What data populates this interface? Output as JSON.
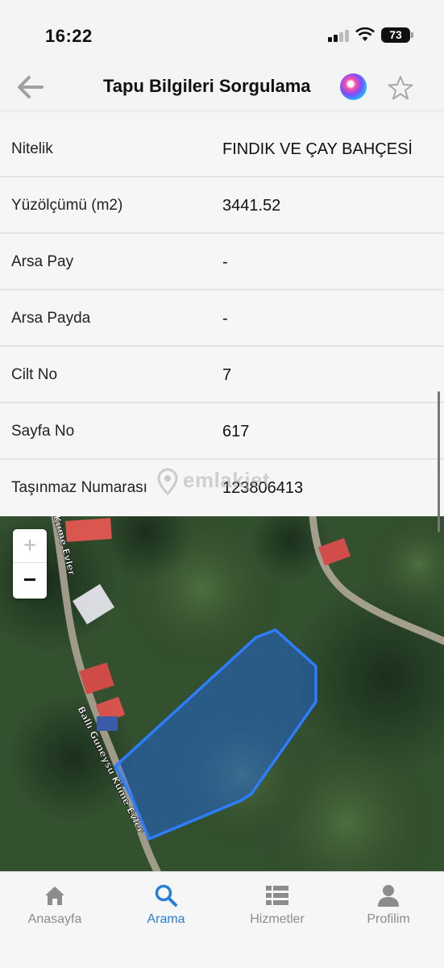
{
  "status_bar": {
    "time": "16:22",
    "battery": "73"
  },
  "header": {
    "title": "Tapu Bilgileri Sorgulama"
  },
  "info_rows": [
    {
      "label": "Nitelik",
      "value": "FINDIK VE ÇAY BAHÇESİ"
    },
    {
      "label": "Yüzölçümü (m2)",
      "value": "3441.52"
    },
    {
      "label": "Arsa Pay",
      "value": "-"
    },
    {
      "label": "Arsa Payda",
      "value": "-"
    },
    {
      "label": "Cilt No",
      "value": "7"
    },
    {
      "label": "Sayfa No",
      "value": "617"
    },
    {
      "label": "Taşınmaz Numarası",
      "value": "123806413"
    }
  ],
  "watermark": "emlakjet",
  "map": {
    "zoom_in": "+",
    "zoom_out": "−",
    "road_label_top": "Küme Evler",
    "road_label_bottom": "Ballı Güneysu Küme Evler",
    "parcel_color": "#1e6cff"
  },
  "tabs": [
    {
      "label": "Anasayfa",
      "icon": "home-icon",
      "active": false
    },
    {
      "label": "Arama",
      "icon": "search-icon",
      "active": true
    },
    {
      "label": "Hizmetler",
      "icon": "list-icon",
      "active": false
    },
    {
      "label": "Profilim",
      "icon": "user-icon",
      "active": false
    }
  ],
  "colors": {
    "accent": "#2a7fd4",
    "inactive": "#8c8c8c"
  }
}
